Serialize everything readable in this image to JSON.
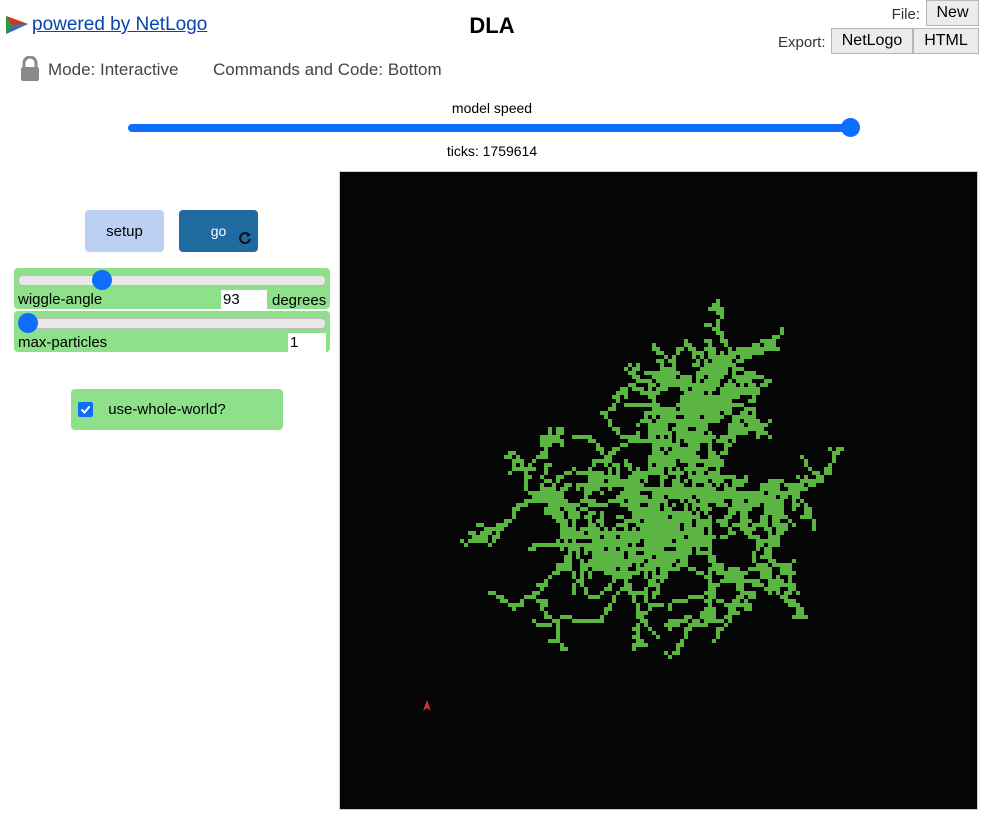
{
  "header": {
    "powered_by": " powered by NetLogo",
    "title": "DLA",
    "file_label": "File:",
    "new_label": "New",
    "export_label": "Export:",
    "export_netlogo_label": "NetLogo",
    "export_html_label": "HTML",
    "mode": "Mode: Interactive",
    "commands_code": "Commands and Code: Bottom"
  },
  "speed": {
    "label": "model speed",
    "ticks_text": "ticks: 1759614"
  },
  "buttons": {
    "setup_label": "setup",
    "go_label": "go"
  },
  "sliders": [
    {
      "name": "wiggle-angle",
      "value": "93",
      "units": "degrees",
      "level": 0.26
    },
    {
      "name": "max-particles",
      "value": "1",
      "units": "",
      "level": 0.0
    }
  ],
  "switch": {
    "label": "use-whole-world?",
    "checked": true
  },
  "colors": {
    "accent": "#0d6efd",
    "widget_green": "#8ee08a",
    "setup_blue": "#bcd0f4",
    "go_blue": "#1f6aa1",
    "cluster_green": "#5cb543",
    "turtle_red": "#d73229",
    "view_bg": "#050505"
  },
  "icons": {
    "logo": "netlogo-logo-icon",
    "lock": "lock-icon",
    "forever": "forever-loop-icon",
    "check": "checkmark-icon"
  }
}
